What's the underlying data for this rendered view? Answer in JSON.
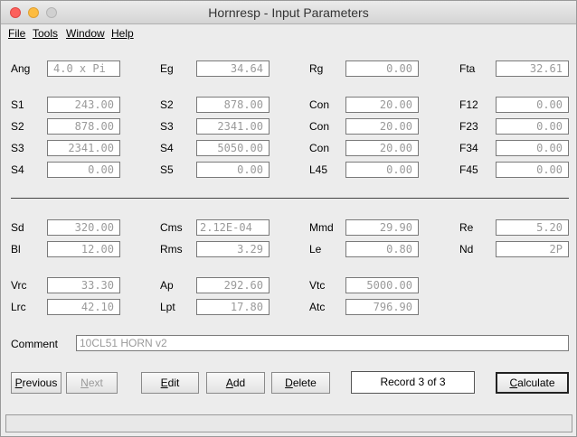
{
  "window": {
    "title": "Hornresp - Input Parameters"
  },
  "menu": {
    "file": "File",
    "tools": "Tools",
    "window": "Window",
    "help": "Help"
  },
  "params": {
    "ang": {
      "label": "Ang",
      "value": "4.0 x Pi"
    },
    "eg": {
      "label": "Eg",
      "value": "34.64"
    },
    "rg": {
      "label": "Rg",
      "value": "0.00"
    },
    "fta": {
      "label": "Fta",
      "value": "32.61"
    },
    "s1": {
      "label": "S1",
      "value": "243.00"
    },
    "s2a": {
      "label": "S2",
      "value": "878.00"
    },
    "con1": {
      "label": "Con",
      "value": "20.00"
    },
    "f12": {
      "label": "F12",
      "value": "0.00"
    },
    "s2b": {
      "label": "S2",
      "value": "878.00"
    },
    "s3a": {
      "label": "S3",
      "value": "2341.00"
    },
    "con2": {
      "label": "Con",
      "value": "20.00"
    },
    "f23": {
      "label": "F23",
      "value": "0.00"
    },
    "s3b": {
      "label": "S3",
      "value": "2341.00"
    },
    "s4a": {
      "label": "S4",
      "value": "5050.00"
    },
    "con3": {
      "label": "Con",
      "value": "20.00"
    },
    "f34": {
      "label": "F34",
      "value": "0.00"
    },
    "s4b": {
      "label": "S4",
      "value": "0.00"
    },
    "s5": {
      "label": "S5",
      "value": "0.00"
    },
    "l45": {
      "label": "L45",
      "value": "0.00"
    },
    "f45": {
      "label": "F45",
      "value": "0.00"
    },
    "sd": {
      "label": "Sd",
      "value": "320.00"
    },
    "cms": {
      "label": "Cms",
      "value": "2.12E-04"
    },
    "mmd": {
      "label": "Mmd",
      "value": "29.90"
    },
    "re": {
      "label": "Re",
      "value": "5.20"
    },
    "bl": {
      "label": "Bl",
      "value": "12.00"
    },
    "rms": {
      "label": "Rms",
      "value": "3.29"
    },
    "le": {
      "label": "Le",
      "value": "0.80"
    },
    "nd": {
      "label": "Nd",
      "value": "2P"
    },
    "vrc": {
      "label": "Vrc",
      "value": "33.30"
    },
    "ap": {
      "label": "Ap",
      "value": "292.60"
    },
    "vtc": {
      "label": "Vtc",
      "value": "5000.00"
    },
    "lrc": {
      "label": "Lrc",
      "value": "42.10"
    },
    "lpt": {
      "label": "Lpt",
      "value": "17.80"
    },
    "atc": {
      "label": "Atc",
      "value": "796.90"
    }
  },
  "comment": {
    "label": "Comment",
    "value": "10CL51 HORN v2"
  },
  "buttons": {
    "previous": {
      "pre": "",
      "key": "P",
      "post": "revious"
    },
    "next": {
      "pre": "",
      "key": "N",
      "post": "ext"
    },
    "edit": {
      "pre": "",
      "key": "E",
      "post": "dit"
    },
    "add": {
      "pre": "",
      "key": "A",
      "post": "dd"
    },
    "delete": {
      "pre": "",
      "key": "D",
      "post": "elete"
    },
    "calculate": {
      "pre": "",
      "key": "C",
      "post": "alculate"
    }
  },
  "record": "Record 3 of 3"
}
